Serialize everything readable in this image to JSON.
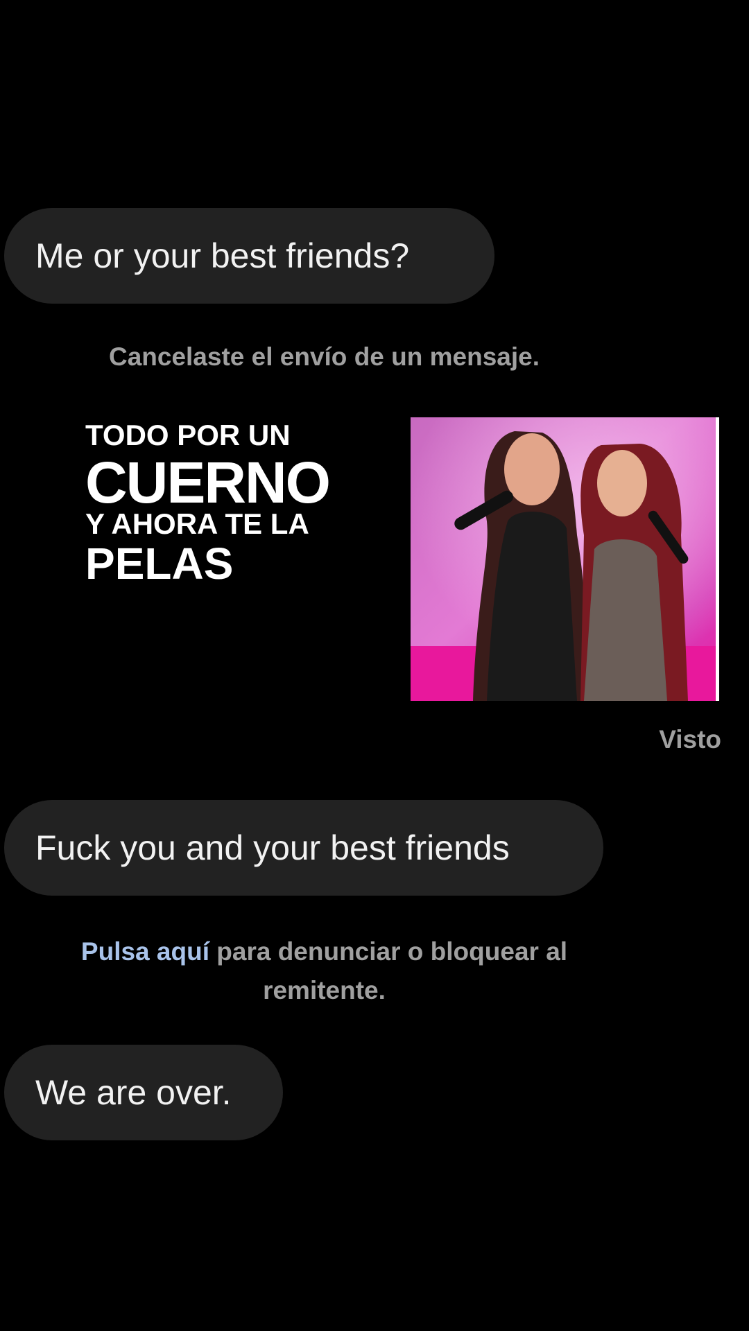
{
  "messages": {
    "first": "Me or your best friends?",
    "second": "Fuck you and your best friends",
    "third": "We are over."
  },
  "system": {
    "unsent": "Cancelaste el envío de un mensaje.",
    "report_link": "Pulsa aquí",
    "report_rest": " para denunciar o bloquear al remitente."
  },
  "meme": {
    "line1": "TODO POR UN",
    "line2": "CUERNO",
    "line3": "Y AHORA TE LA",
    "line4": "PELAS"
  },
  "status": {
    "seen": "Visto"
  },
  "colors": {
    "background": "#000000",
    "bubble": "#222222",
    "system_text": "#a0a0a0",
    "link": "#a9c3ea"
  }
}
